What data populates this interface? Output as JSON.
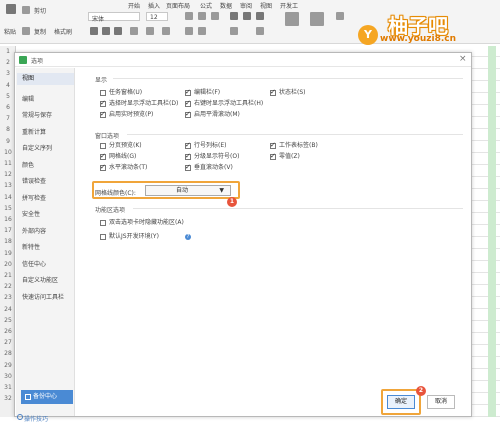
{
  "ribbon": {
    "tab_labels": [
      "开始",
      "插入",
      "页面布局",
      "公式",
      "数据",
      "审阅",
      "视图",
      "开发工"
    ],
    "paste_label": "粘贴",
    "cut_label": "剪切",
    "copy_label": "复制",
    "format_painter_label": "格式刷",
    "font_name": "宋体",
    "font_size": "12"
  },
  "logo": {
    "badge": "Y",
    "name": "柚子吧",
    "url": "www.youzi8.cn"
  },
  "row_numbers": [
    "1",
    "2",
    "3",
    "4",
    "5",
    "6",
    "7",
    "8",
    "9",
    "10",
    "11",
    "12",
    "13",
    "14",
    "15",
    "16",
    "17",
    "18",
    "19",
    "20",
    "21",
    "22",
    "23",
    "24",
    "25",
    "26",
    "27",
    "28",
    "29",
    "30",
    "31",
    "32"
  ],
  "dialog": {
    "title": "选项",
    "close_glyph": "×",
    "sidebar_items": [
      {
        "label": "视图"
      },
      {
        "label": "编辑"
      },
      {
        "label": "常规与保存"
      },
      {
        "label": "重新计算"
      },
      {
        "label": "自定义序列"
      },
      {
        "label": "颜色"
      },
      {
        "label": "错误检查"
      },
      {
        "label": "拼写检查"
      },
      {
        "label": "安全性"
      },
      {
        "label": "外部内容"
      },
      {
        "label": "新特性"
      },
      {
        "label": "信任中心"
      },
      {
        "label": "自定义功能区"
      },
      {
        "label": "快速访问工具栏"
      }
    ],
    "backup_label": "备份中心",
    "tips_label": "操作技巧",
    "display": {
      "title": "显示",
      "options": [
        {
          "label": "任务窗格(U)",
          "checked": false
        },
        {
          "label": "编辑栏(F)",
          "checked": true
        },
        {
          "label": "状态栏(S)",
          "checked": true
        },
        {
          "label": "选择时显示浮动工具栏(D)",
          "checked": true
        },
        {
          "label": "右键时显示浮动工具栏(H)",
          "checked": true
        },
        {
          "label": "启用实时预览(P)",
          "checked": true
        },
        {
          "label": "启用平滑滚动(M)",
          "checked": true
        }
      ]
    },
    "window": {
      "title": "窗口选项",
      "options": [
        {
          "label": "分页预览(K)",
          "checked": false
        },
        {
          "label": "行号列标(E)",
          "checked": true
        },
        {
          "label": "工作表标签(B)",
          "checked": true
        },
        {
          "label": "网格线(G)",
          "checked": true
        },
        {
          "label": "分级显示符号(O)",
          "checked": true
        },
        {
          "label": "零值(Z)",
          "checked": true
        },
        {
          "label": "水平滚动条(T)",
          "checked": true
        },
        {
          "label": "垂直滚动条(V)",
          "checked": true
        }
      ],
      "grid_color_label": "网格线颜色(C):",
      "grid_color_value": "自动",
      "dropdown_arrow": "▼"
    },
    "ribbon_options": {
      "title": "功能区选项",
      "options": [
        {
          "label": "双击选项卡时隐藏功能区(A)",
          "checked": false
        },
        {
          "label": "默认JS开发环境(Y)",
          "checked": false
        }
      ],
      "help_glyph": "?"
    },
    "badge_1": "1",
    "badge_2": "2",
    "ok_label": "确定",
    "cancel_label": "取消"
  },
  "colors": {
    "accent": "#f0a53a",
    "badge": "#e8543c",
    "primary": "#4a8ad4"
  }
}
